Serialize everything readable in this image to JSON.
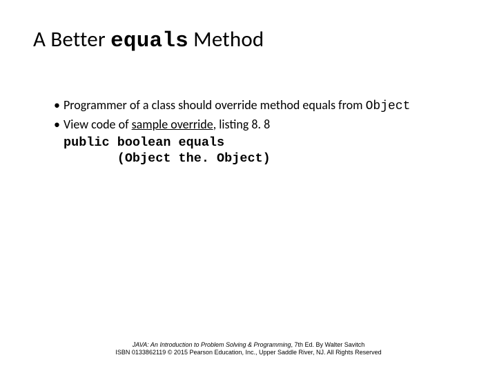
{
  "title": {
    "pre": "A Better ",
    "mono": "equals",
    "post": " Method"
  },
  "bullets": {
    "b1": {
      "pre": "Programmer of a class should override method equals from ",
      "mono": "Object"
    },
    "b2": {
      "pre": "View code of ",
      "link": "sample override",
      "post": ", listing 8. 8"
    }
  },
  "code": {
    "line1": "public boolean equals",
    "line2": "       (Object the. Object)"
  },
  "footer": {
    "book": "JAVA: An Introduction to Problem Solving & Programming",
    "edition": ", 7th Ed. By Walter Savitch",
    "line2": "ISBN 0133862119 © 2015 Pearson Education, Inc., Upper Saddle River, NJ. All Rights Reserved"
  }
}
